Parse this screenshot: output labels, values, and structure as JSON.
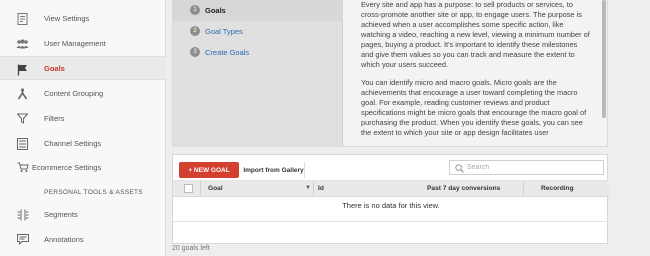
{
  "sidebar": {
    "items": [
      {
        "label": "View Settings",
        "icon": "view-settings-icon"
      },
      {
        "label": "User Management",
        "icon": "users-icon"
      },
      {
        "label": "Goals",
        "icon": "flag-icon"
      },
      {
        "label": "Content Grouping",
        "icon": "content-grouping-icon"
      },
      {
        "label": "Filters",
        "icon": "filter-icon"
      },
      {
        "label": "Channel Settings",
        "icon": "channel-settings-icon"
      },
      {
        "label": "Ecommerce Settings",
        "icon": "cart-icon"
      }
    ],
    "section_title": "PERSONAL TOOLS & ASSETS",
    "tools": [
      {
        "label": "Segments",
        "icon": "segments-icon"
      },
      {
        "label": "Annotations",
        "icon": "annotations-icon"
      }
    ],
    "accent": "#c3362b"
  },
  "steps": [
    {
      "num": "1",
      "label": "Goals"
    },
    {
      "num": "2",
      "label": "Goal Types"
    },
    {
      "num": "3",
      "label": "Create Goals"
    }
  ],
  "info": {
    "p1": "Every site and app has a purpose: to sell products or services, to cross-promote another site or app, to engage users. The purpose is achieved when a user accomplishes some specific action, like watching a video, reaching a new level, viewing a minimum number of pages, buying a product. It's important to identify these milestones and give them values so you can track and measure the extent to which your users succeed.",
    "p2": "You can identify micro and macro goals. Micro goals are the achievements that encourage a user toward completing the macro goal. For example, reading customer reviews and product specifications might be micro goals that encourage the macro goal of purchasing the product. When you identify these goals, you can see the extent to which your site or app design facilitates user"
  },
  "toolbar": {
    "new_goal": "+ NEW GOAL",
    "import": "Import from Gallery",
    "search_placeholder": "Search",
    "new_goal_color": "#d44030"
  },
  "table": {
    "columns": [
      "Goal",
      "Id",
      "Past 7 day conversions",
      "Recording"
    ],
    "empty": "There is no data for this view."
  },
  "footer": {
    "goals_left": "20 goals left"
  }
}
